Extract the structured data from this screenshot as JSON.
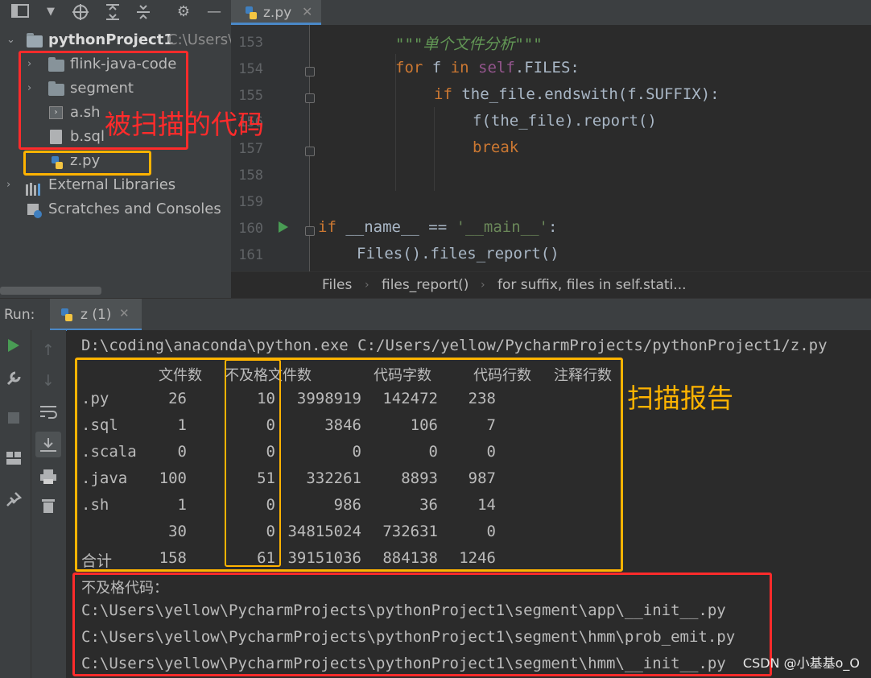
{
  "editor_tab": {
    "filename": "z.py",
    "close": "✕"
  },
  "project": {
    "root_name": "pythonProject1",
    "root_path": "C:\\Users\\y",
    "items": [
      {
        "label": "flink-java-code"
      },
      {
        "label": "segment"
      },
      {
        "label": "a.sh"
      },
      {
        "label": "b.sql"
      },
      {
        "label": "z.py"
      },
      {
        "label": "External Libraries"
      },
      {
        "label": "Scratches and Consoles"
      }
    ]
  },
  "code": {
    "line_numbers": [
      "153",
      "154",
      "155",
      "156",
      "157",
      "158",
      "159",
      "160",
      "161"
    ],
    "docstring": "\"\"\"单个文件分析\"\"\"",
    "l154_kw1": "for",
    "l154_mid": " f ",
    "l154_kw2": "in",
    "l154_self": "self",
    "l154_rest": ".FILES:",
    "l155_kw": "if",
    "l155_rest": " the_file.endswith(f.SUFFIX):",
    "l156": "f(the_file).report()",
    "l157": "break",
    "l160_kw": "if",
    "l160_a": " __name__ == ",
    "l160_str": "'__main__'",
    "l160_b": ":",
    "l161": "Files().files_report()"
  },
  "breadcrumb": [
    "Files",
    "files_report()",
    "for suffix, files in self.stati..."
  ],
  "run": {
    "label": "Run:",
    "tab": "z (1)",
    "close": "✕",
    "command": "D:\\coding\\anaconda\\python.exe C:/Users/yellow/PycharmProjects/pythonProject1/z.py",
    "headers": [
      "文件数",
      "不及格文件数",
      "代码字数",
      "代码行数",
      "注释行数"
    ],
    "rows": [
      [
        ".py",
        "26",
        "10",
        "3998919",
        "142472",
        "238"
      ],
      [
        ".sql",
        "1",
        "0",
        "3846",
        "106",
        "7"
      ],
      [
        ".scala",
        "0",
        "0",
        "0",
        "0",
        "0"
      ],
      [
        ".java",
        "100",
        "51",
        "332261",
        "8893",
        "987"
      ],
      [
        ".sh",
        "1",
        "0",
        "986",
        "36",
        "14"
      ],
      [
        "",
        "30",
        "0",
        "34815024",
        "732631",
        "0"
      ],
      [
        "合计",
        "158",
        "61",
        "39151036",
        "884138",
        "1246"
      ]
    ],
    "failed_title": "不及格代码：",
    "failed_files": [
      "C:\\Users\\yellow\\PycharmProjects\\pythonProject1\\segment\\app\\__init__.py",
      "C:\\Users\\yellow\\PycharmProjects\\pythonProject1\\segment\\hmm\\prob_emit.py",
      "C:\\Users\\yellow\\PycharmProjects\\pythonProject1\\segment\\hmm\\__init__.py"
    ]
  },
  "annotations": {
    "scanned_code": "被扫描的代码",
    "scan_report": "扫描报告",
    "red": "#ff2b2b",
    "orange": "#ffb300"
  },
  "watermark": "CSDN @小基基o_O",
  "colors": {
    "accent": "#4a88c7",
    "run_green": "#499c54"
  }
}
